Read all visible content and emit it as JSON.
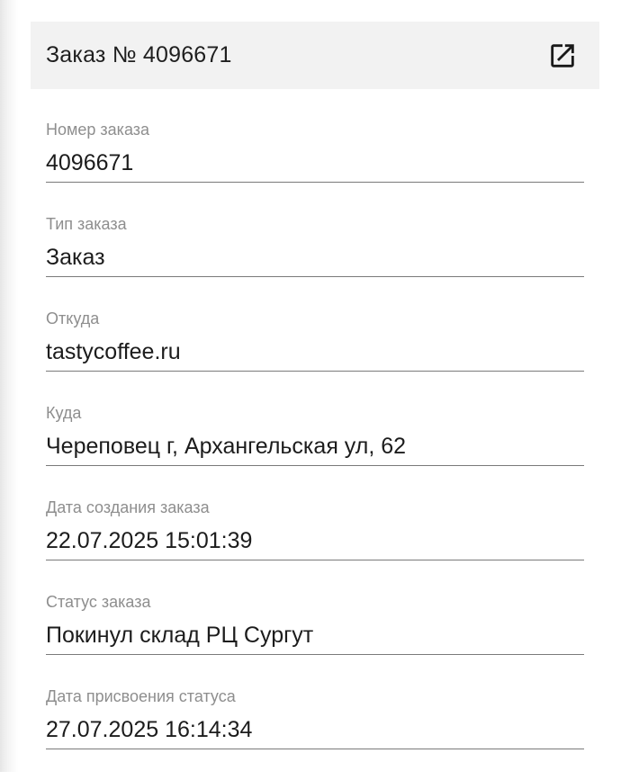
{
  "header": {
    "title": "Заказ № 4096671",
    "open_icon": "open-in-new-icon"
  },
  "fields": [
    {
      "label": "Номер заказа",
      "value": "4096671"
    },
    {
      "label": "Тип заказа",
      "value": "Заказ"
    },
    {
      "label": "Откуда",
      "value": "tastycoffee.ru"
    },
    {
      "label": "Куда",
      "value": "Череповец г, Архангельская ул, 62"
    },
    {
      "label": "Дата создания заказа",
      "value": "22.07.2025 15:01:39"
    },
    {
      "label": "Статус заказа",
      "value": "Покинул склад РЦ Сургут"
    },
    {
      "label": "Дата присвоения статуса",
      "value": "27.07.2025 16:14:34"
    }
  ]
}
